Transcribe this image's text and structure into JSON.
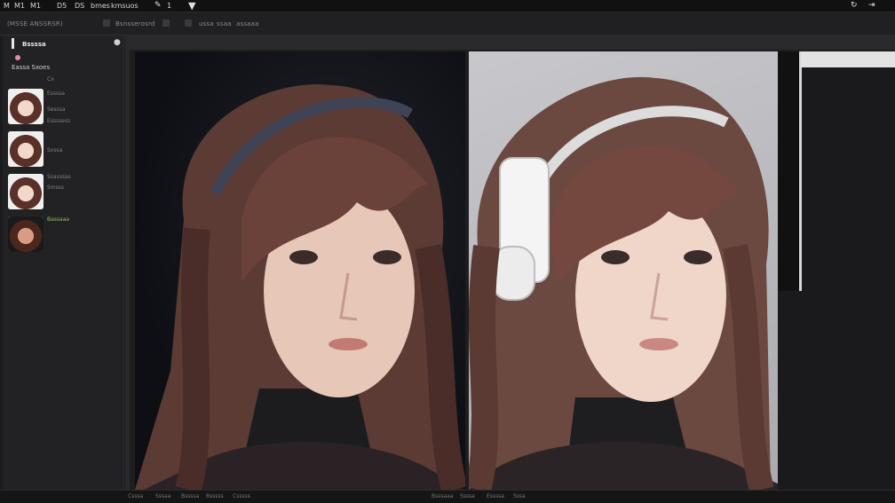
{
  "menubar": {
    "items": [
      "M",
      "M1",
      "M1",
      "D5",
      "DS",
      "bmes",
      "kmsuos",
      "1"
    ],
    "dropdown_icon": "caret-down-icon",
    "right_icons": [
      "refresh-icon",
      "panel-toggle-icon"
    ]
  },
  "toolbar": {
    "tabs": [
      "(MSSE ANSSRSR)",
      "Bsnsserosrd",
      "ussa",
      "ssaa",
      "assaaa"
    ]
  },
  "left_panel": {
    "title": "Bssssa",
    "subtitle": "Eassa Sxoes",
    "items": [
      {
        "label_a": "Cx",
        "label_b": "Essssa"
      },
      {
        "label_a": "Sesssa",
        "label_b": "Essssess"
      },
      {
        "label_a": "Sxssa",
        "label_b": "Ssasssas"
      },
      {
        "label_a": "Smsss",
        "label_b": "Bassaaa"
      }
    ]
  },
  "statusbar": {
    "items": [
      "Csssa",
      "Sssaa",
      "Bssssa",
      "Bsssss",
      "Csssss",
      "Bsssaaa",
      "Ssssa",
      "Essssa",
      "Sssa"
    ]
  },
  "colors": {
    "background": "#1b1b1d",
    "panel": "#222224",
    "accent": "#9dbb6a",
    "highlight": "#e3e3e3"
  }
}
